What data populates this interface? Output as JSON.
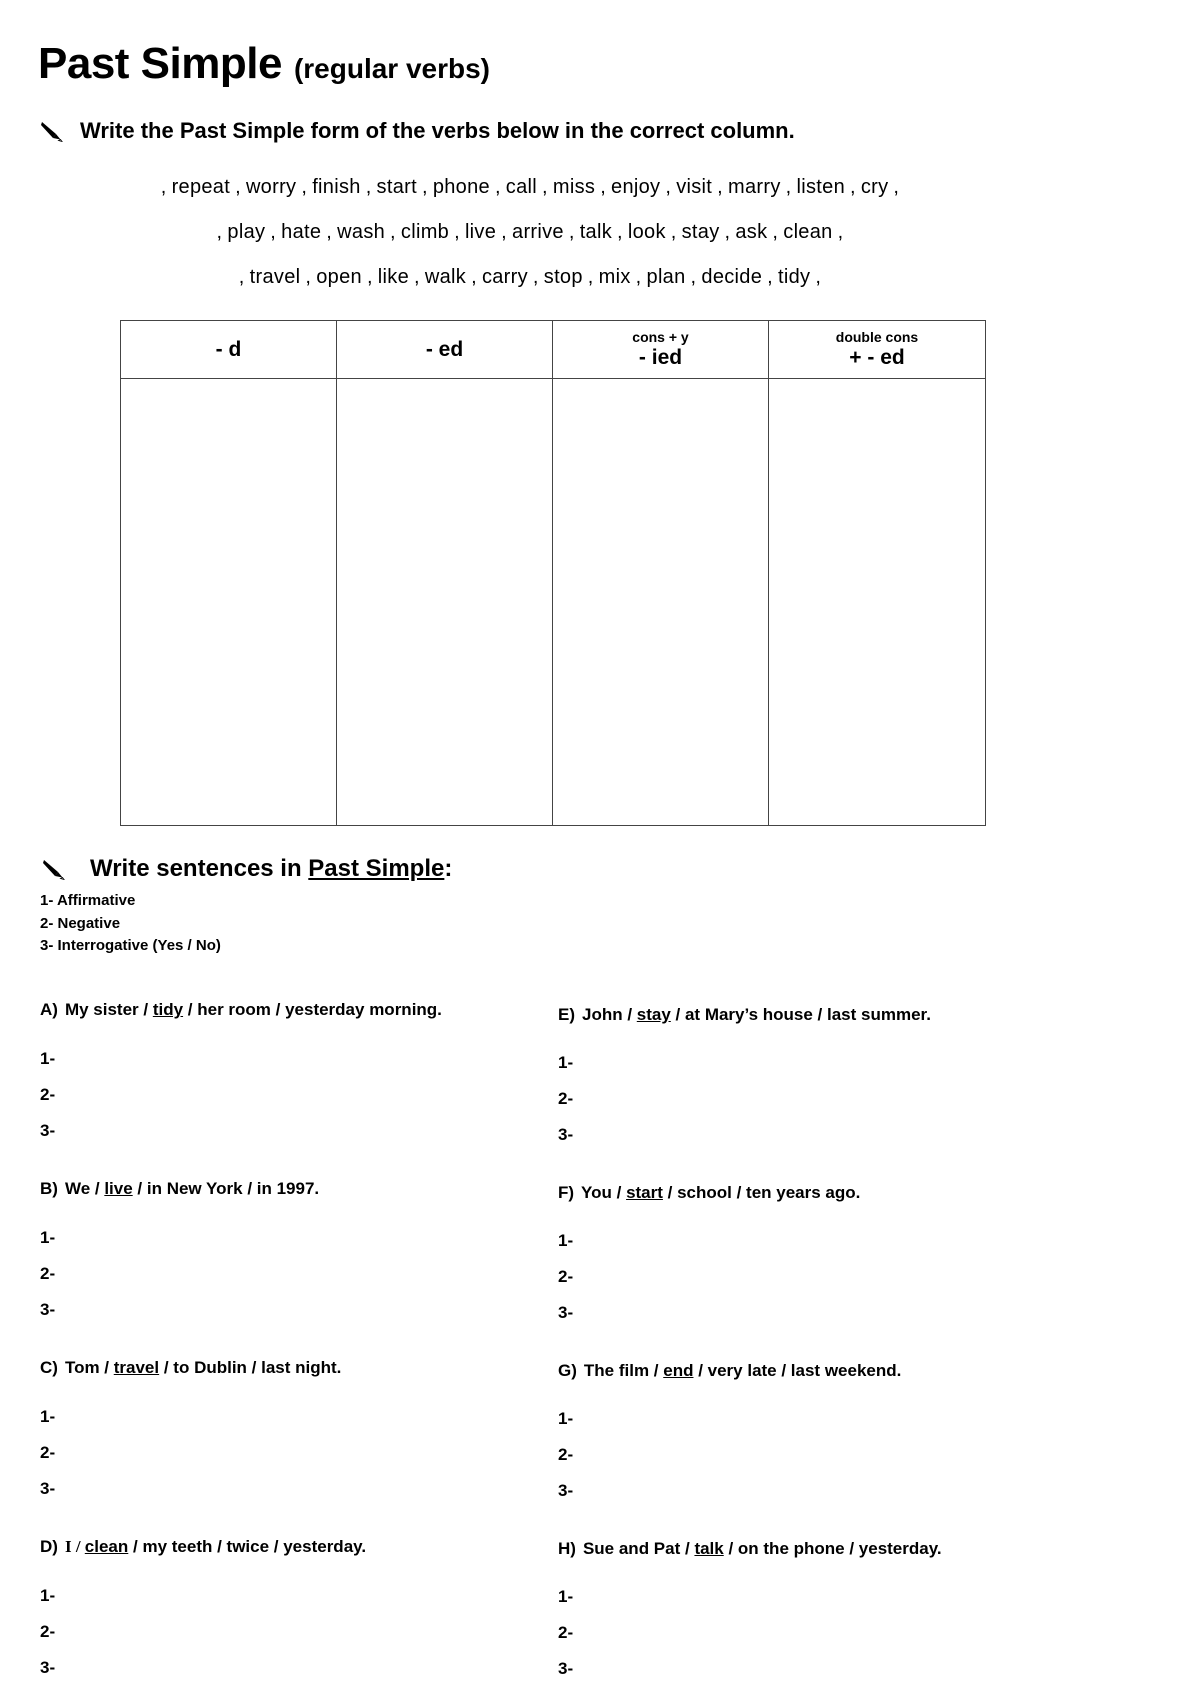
{
  "title": {
    "main": "Past Simple",
    "sub": "(regular verbs)"
  },
  "instruction_1": {
    "icon": "pencil-icon",
    "text": "Write the Past Simple form of the verbs below in the correct column."
  },
  "verb_list": {
    "rows": [
      [
        "repeat",
        "worry",
        "finish",
        "start",
        "phone",
        "call",
        "miss",
        "enjoy",
        "visit",
        "marry",
        "listen",
        "cry"
      ],
      [
        "play",
        "hate",
        "wash",
        "climb",
        "live",
        "arrive",
        "talk",
        "look",
        "stay",
        "ask",
        "clean"
      ],
      [
        "travel",
        "open",
        "like",
        "walk",
        "carry",
        "stop",
        "mix",
        "plan",
        "decide",
        "tidy"
      ]
    ],
    "separator": ","
  },
  "table": {
    "headers": [
      {
        "small": "",
        "big": "- d"
      },
      {
        "small": "",
        "big": "- ed"
      },
      {
        "small": "cons + y",
        "big": "- ied"
      },
      {
        "small": "double cons",
        "big": "+ - ed"
      }
    ],
    "cells": [
      "",
      "",
      "",
      ""
    ]
  },
  "instruction_2": {
    "icon": "pencil-icon",
    "text_before": "Write sentences in ",
    "text_underlined": "Past Simple",
    "text_after": ":"
  },
  "modes": [
    "1- Affirmative",
    "2- Negative",
    "3- Interrogative (Yes / No)"
  ],
  "answer_labels": [
    "1-",
    "2-",
    "3-"
  ],
  "exercises_left": [
    {
      "letter": "A)",
      "before": "My sister / ",
      "verb": "tidy",
      "after": " / her room / yesterday morning."
    },
    {
      "letter": "B)",
      "before": "We / ",
      "verb": "live",
      "after": " / in New York / in 1997."
    },
    {
      "letter": "C)",
      "before": "Tom / ",
      "verb": "travel",
      "after": " / to Dublin / last night."
    },
    {
      "letter": "D)",
      "before": "I / ",
      "verb": "clean",
      "after": " / my teeth / twice / yesterday."
    }
  ],
  "exercises_right": [
    {
      "letter": "E)",
      "before": "John / ",
      "verb": "stay",
      "after": " / at Mary’s house / last summer."
    },
    {
      "letter": "F)",
      "before": "You / ",
      "verb": "start",
      "after": " / school / ten years ago."
    },
    {
      "letter": "G)",
      "before": "The film / ",
      "verb": "end",
      "after": " / very late / last weekend."
    },
    {
      "letter": "H)",
      "before": "Sue and Pat  / ",
      "verb": "talk",
      "after": " / on the phone / yesterday."
    }
  ],
  "colors": {
    "text": "#000000",
    "background": "#ffffff",
    "table_border": "#444444"
  }
}
